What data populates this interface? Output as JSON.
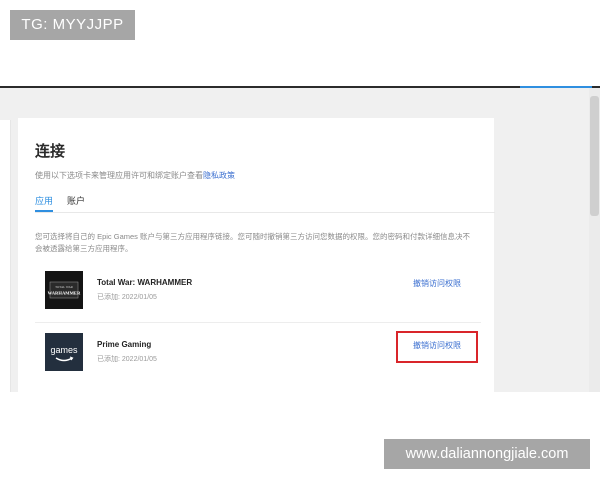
{
  "overlay": {
    "tg_badge": "TG: MYYJJPP",
    "watermark": "www.daliannongjiale.com"
  },
  "page": {
    "title": "连接",
    "subtitle_text": "使用以下选项卡来管理应用许可和绑定账户查看",
    "subtitle_link": "隐私政策",
    "tabs": [
      {
        "label": "应用",
        "active": true
      },
      {
        "label": "账户",
        "active": false
      }
    ],
    "description": "您可选择将自己的 Epic Games 账户与第三方应用程序链接。您可随时撤销第三方访问您数据的权限。您的密码和付款详细信息决不会被透露给第三方应用程序。"
  },
  "apps": [
    {
      "name": "Total War: WARHAMMER",
      "date": "已添加: 2022/01/05",
      "revoke_label": "撤销访问权限",
      "logo_text": "WARHAMMER",
      "logo_top_text": "TOTAL WAR"
    },
    {
      "name": "Prime Gaming",
      "date": "已添加: 2022/01/05",
      "revoke_label": "撤销访问权限",
      "logo_text": "games"
    }
  ],
  "colors": {
    "accent": "#2f8fe0",
    "link": "#3b6fd0",
    "highlight": "#d9252a"
  }
}
